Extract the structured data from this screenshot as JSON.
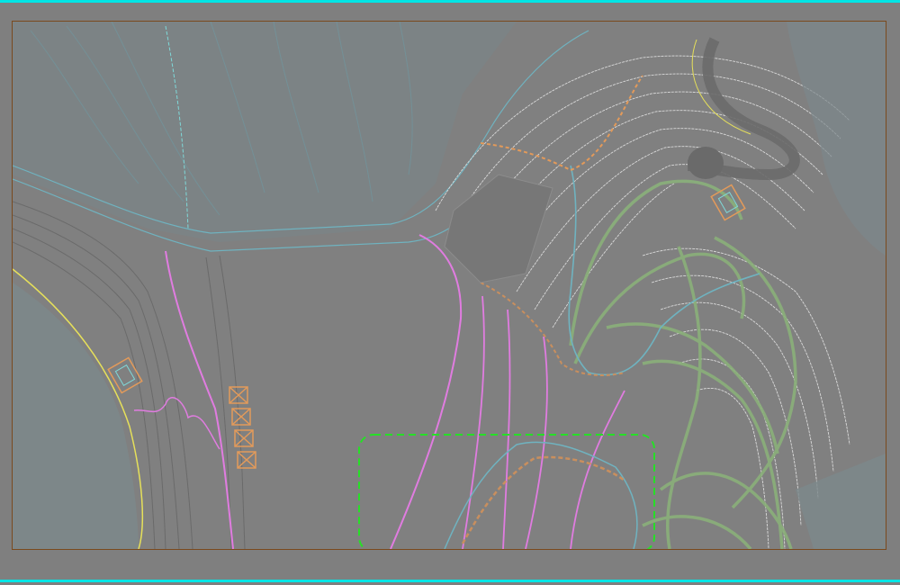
{
  "app": {
    "title": ""
  },
  "colors": {
    "background": "#7f7f7f",
    "frame_border": "#7a4a1e",
    "accent_cyan": "#00e5e5",
    "contour_white": "#d9d9d9",
    "contour_dark": "#6f6f6f",
    "water_teal": "#6fb3c0",
    "path_green": "#8ab07a",
    "road_magenta": "#e07ce0",
    "boundary_yellow": "#e6e05a",
    "structure_orange": "#e39a5a",
    "selection_green": "#26e026"
  },
  "drawing": {
    "layers": [
      {
        "name": "contours"
      },
      {
        "name": "paths"
      },
      {
        "name": "roads"
      },
      {
        "name": "structures"
      }
    ],
    "selection": {
      "style": "dashed",
      "color": "#26e026"
    }
  }
}
